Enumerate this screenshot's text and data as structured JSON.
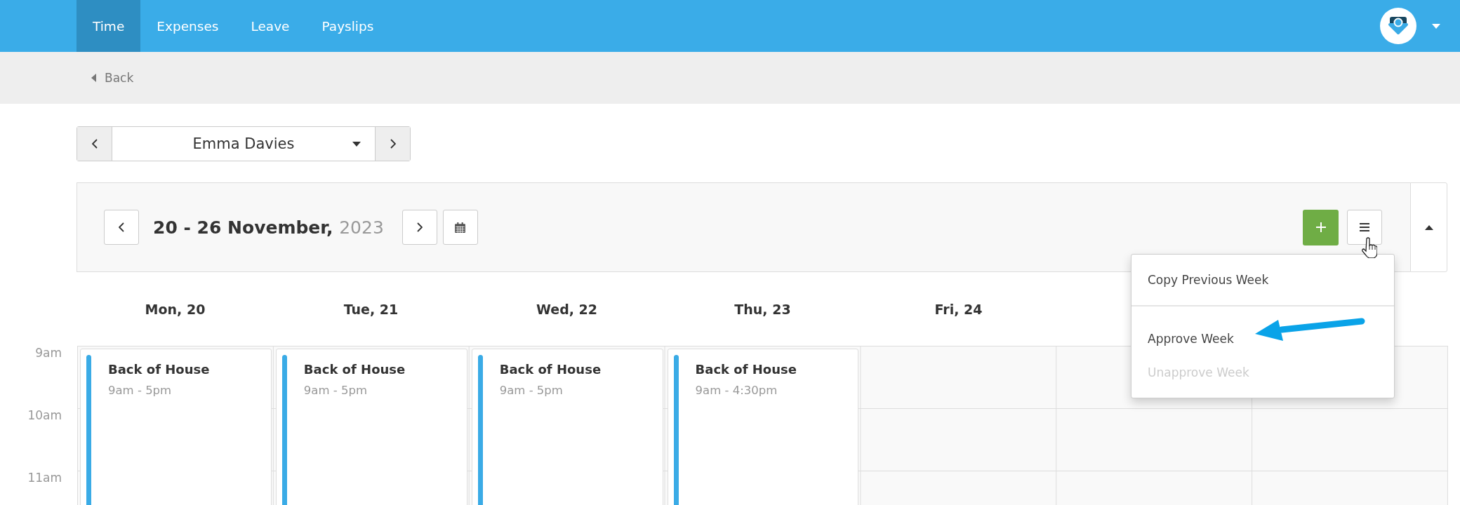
{
  "nav": {
    "tabs": [
      {
        "label": "Time",
        "selected": true
      },
      {
        "label": "Expenses",
        "selected": false
      },
      {
        "label": "Leave",
        "selected": false
      },
      {
        "label": "Payslips",
        "selected": false
      }
    ]
  },
  "back_link": {
    "label": "Back"
  },
  "employee_selector": {
    "value": "Emma Davies"
  },
  "week": {
    "range": "20 - 26 November,",
    "year": "2023"
  },
  "menu": {
    "items": [
      {
        "label": "Copy Previous Week",
        "disabled": false,
        "divider_after": true
      },
      {
        "label": "Approve Week",
        "disabled": false,
        "divider_after": false
      },
      {
        "label": "Unapprove Week",
        "disabled": true,
        "divider_after": false
      }
    ]
  },
  "calendar": {
    "day_headers": [
      "Mon, 20",
      "Tue, 21",
      "Wed, 22",
      "Thu, 23",
      "Fri, 24"
    ],
    "time_labels": [
      "9am",
      "10am",
      "11am"
    ],
    "shifts": [
      {
        "title": "Back of House",
        "time": "9am - 5pm",
        "color": "#3aabe6"
      },
      {
        "title": "Back of House",
        "time": "9am - 5pm",
        "color": "#3aabe6"
      },
      {
        "title": "Back of House",
        "time": "9am - 5pm",
        "color": "#3aabe6"
      },
      {
        "title": "Back of House",
        "time": "9am - 4:30pm",
        "color": "#3aabe6"
      }
    ]
  }
}
